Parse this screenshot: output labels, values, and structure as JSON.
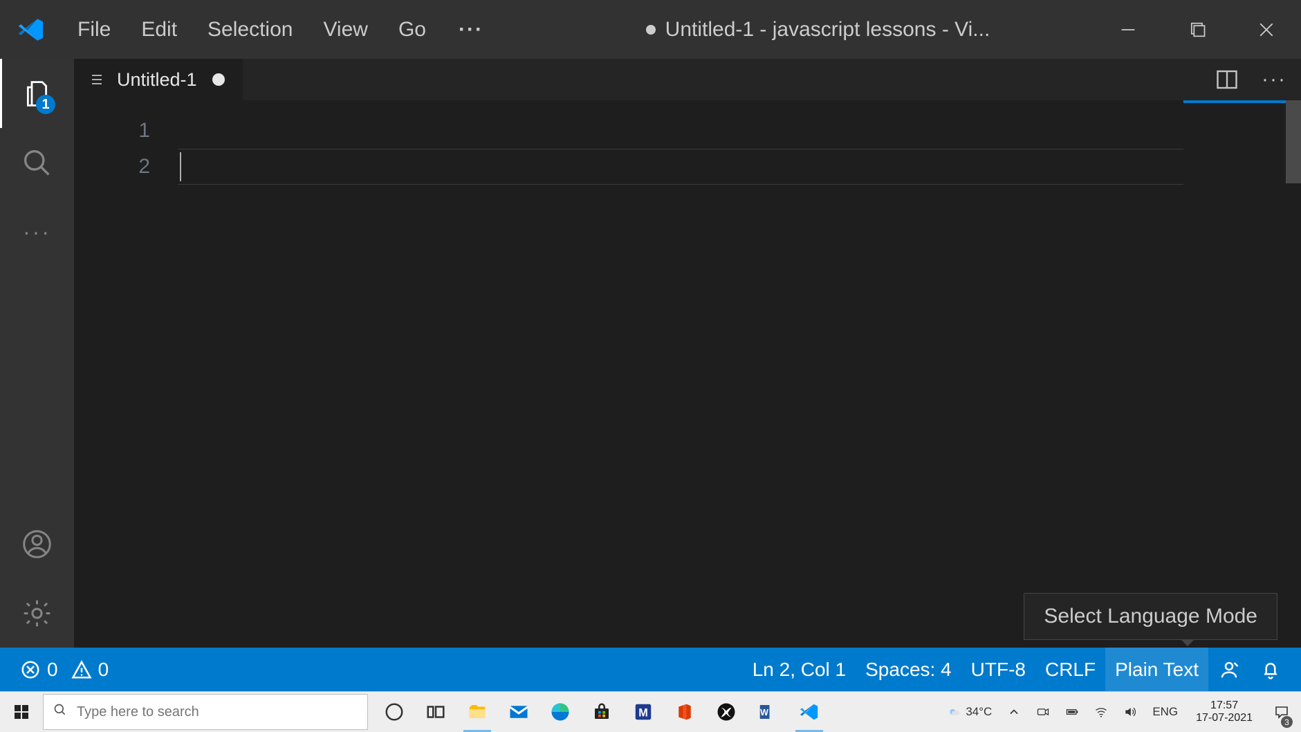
{
  "title_bar": {
    "menus": [
      "File",
      "Edit",
      "Selection",
      "View",
      "Go"
    ],
    "ellipsis": "···",
    "window_title": "Untitled-1 - javascript lessons - Vi..."
  },
  "activity": {
    "explorer_badge": "1"
  },
  "editor": {
    "tab_label": "Untitled-1",
    "line_numbers": [
      "1",
      "2"
    ],
    "tabs_more": "···"
  },
  "tooltip": {
    "text": "Select Language Mode"
  },
  "status_bar": {
    "errors": "0",
    "warnings": "0",
    "cursor": "Ln 2, Col 1",
    "spaces": "Spaces: 4",
    "encoding": "UTF-8",
    "eol": "CRLF",
    "language": "Plain Text"
  },
  "taskbar": {
    "search_placeholder": "Type here to search",
    "weather_temp": "34°C",
    "lang": "ENG",
    "time": "17:57",
    "date": "17-07-2021",
    "notif_count": "3"
  }
}
